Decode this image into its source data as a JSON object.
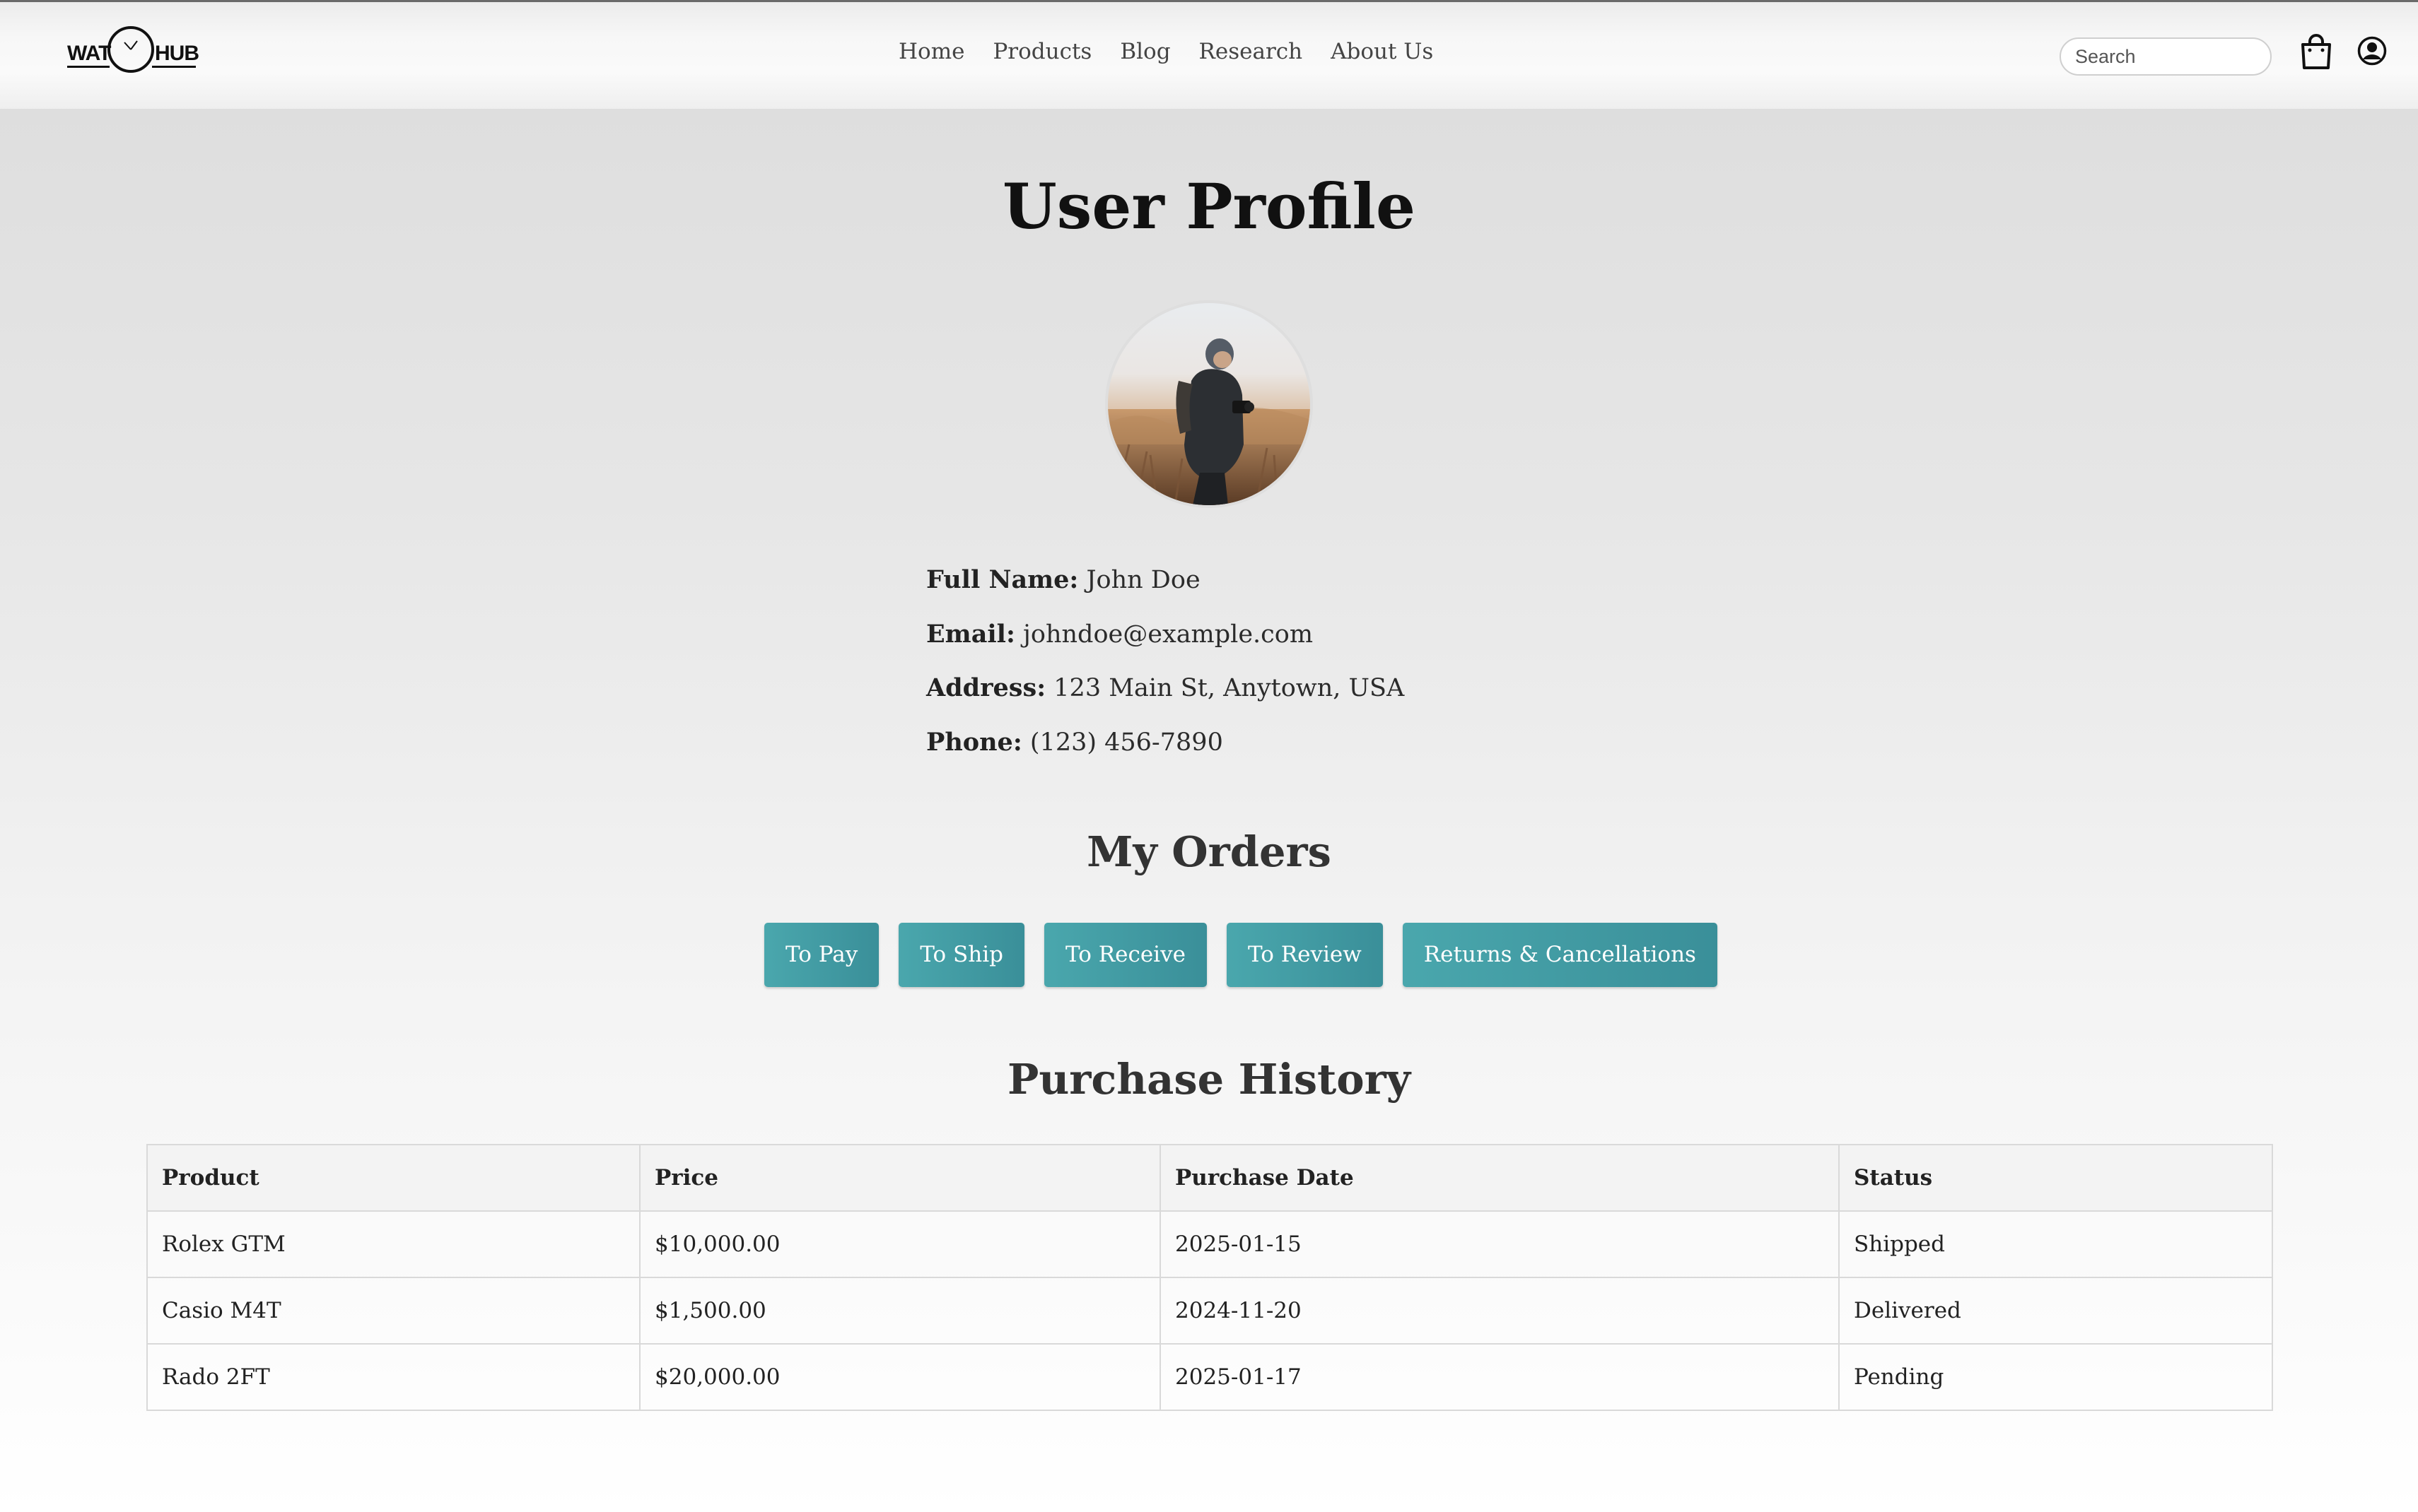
{
  "header": {
    "logo": {
      "left_text": "WAT",
      "right_text": "HUB"
    },
    "nav": [
      "Home",
      "Products",
      "Blog",
      "Research",
      "About Us"
    ],
    "search_placeholder": "Search",
    "icons": {
      "cart": "shopping-bag-icon",
      "user": "user-circle-icon"
    }
  },
  "page_title": "User Profile",
  "profile": {
    "avatar": "avatar",
    "fields": [
      {
        "label": "Full Name:",
        "value": "John Doe"
      },
      {
        "label": "Email:",
        "value": "johndoe@example.com"
      },
      {
        "label": "Address:",
        "value": "123 Main St, Anytown, USA"
      },
      {
        "label": "Phone:",
        "value": "(123) 456-7890"
      }
    ]
  },
  "orders": {
    "title": "My Orders",
    "tabs": [
      "To Pay",
      "To Ship",
      "To Receive",
      "To Review",
      "Returns & Cancellations"
    ]
  },
  "history": {
    "title": "Purchase History",
    "columns": [
      "Product",
      "Price",
      "Purchase Date",
      "Status"
    ],
    "rows": [
      [
        "Rolex GTM",
        "$10,000.00",
        "2025-01-15",
        "Shipped"
      ],
      [
        "Casio M4T",
        "$1,500.00",
        "2024-11-20",
        "Delivered"
      ],
      [
        "Rado 2FT",
        "$20,000.00",
        "2025-01-17",
        "Pending"
      ]
    ]
  },
  "colors": {
    "button_start": "#4aa7ad",
    "button_end": "#3a8f99"
  }
}
